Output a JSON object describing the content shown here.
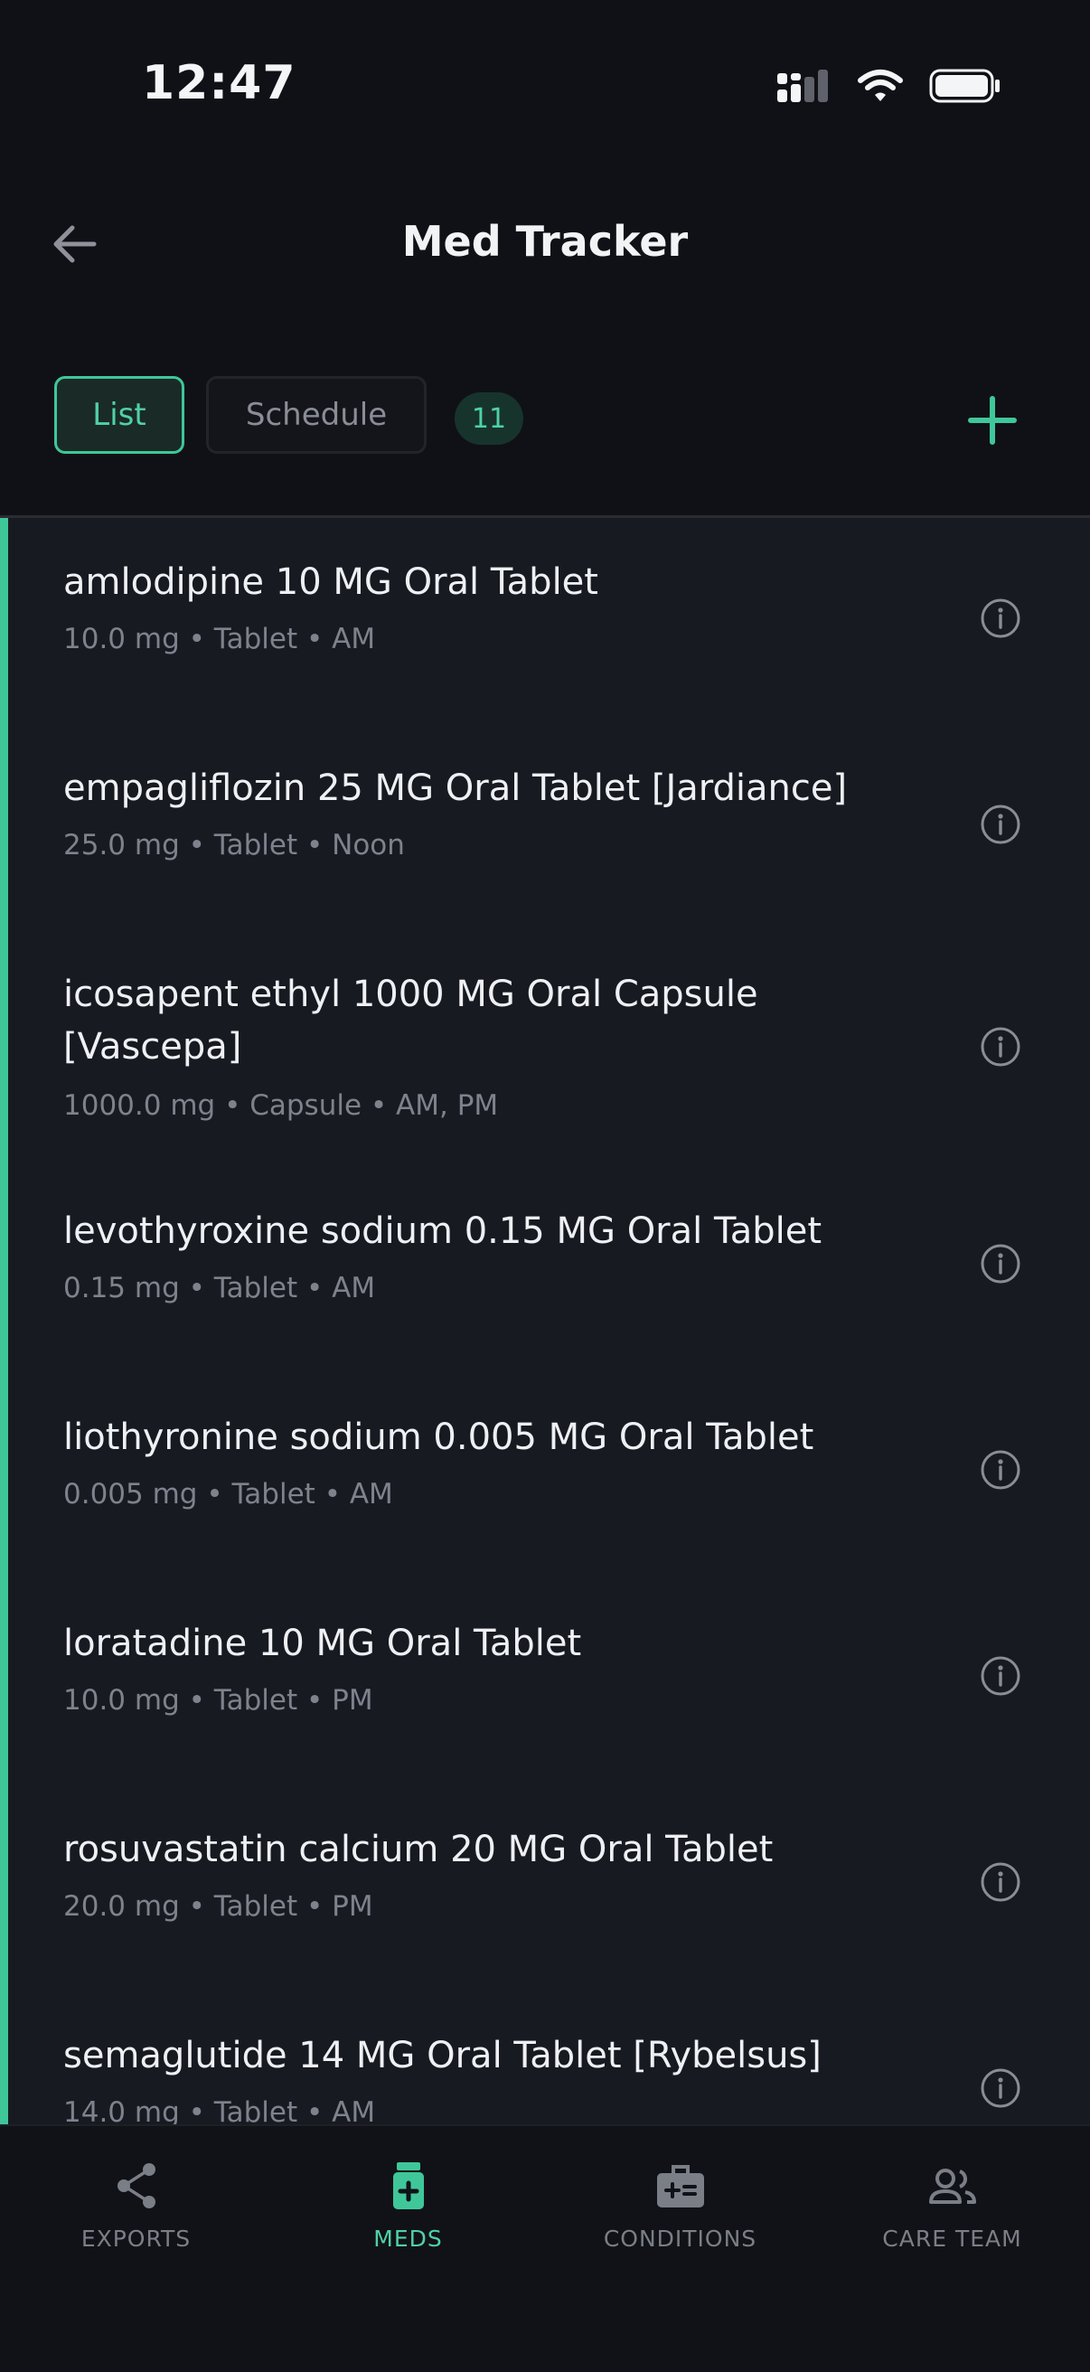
{
  "status_bar": {
    "time": "12:47"
  },
  "header": {
    "title": "Med Tracker"
  },
  "toolbar": {
    "tabs": [
      {
        "label": "List",
        "active": true
      },
      {
        "label": "Schedule",
        "active": false
      }
    ],
    "count": "11"
  },
  "medications": [
    {
      "name": "amlodipine 10 MG Oral Tablet",
      "dose": "10.0 mg",
      "form": "Tablet",
      "time": "AM"
    },
    {
      "name": "empagliflozin 25 MG Oral Tablet [Jardiance]",
      "dose": "25.0 mg",
      "form": "Tablet",
      "time": "Noon"
    },
    {
      "name": "icosapent ethyl 1000 MG Oral Capsule [Vascepa]",
      "dose": "1000.0 mg",
      "form": "Capsule",
      "time": "AM, PM"
    },
    {
      "name": "levothyroxine sodium 0.15 MG Oral Tablet",
      "dose": "0.15 mg",
      "form": "Tablet",
      "time": "AM"
    },
    {
      "name": "liothyronine sodium 0.005 MG Oral Tablet",
      "dose": "0.005 mg",
      "form": "Tablet",
      "time": "AM"
    },
    {
      "name": "loratadine 10 MG Oral Tablet",
      "dose": "10.0 mg",
      "form": "Tablet",
      "time": "PM"
    },
    {
      "name": "rosuvastatin calcium 20 MG Oral Tablet",
      "dose": "20.0 mg",
      "form": "Tablet",
      "time": "PM"
    },
    {
      "name": "semaglutide 14 MG Oral Tablet [Rybelsus]",
      "dose": "14.0 mg",
      "form": "Tablet",
      "time": "AM"
    }
  ],
  "separator": "•",
  "bottom_nav": [
    {
      "label": "EXPORTS",
      "icon": "share-icon",
      "active": false
    },
    {
      "label": "MEDS",
      "icon": "medicine-bottle-icon",
      "active": true
    },
    {
      "label": "CONDITIONS",
      "icon": "medical-kit-icon",
      "active": false
    },
    {
      "label": "CARE TEAM",
      "icon": "people-icon",
      "active": false
    }
  ],
  "colors": {
    "accent": "#3fc79a",
    "background": "#101116",
    "list_background": "#181a22",
    "muted_text": "#7e828c"
  }
}
